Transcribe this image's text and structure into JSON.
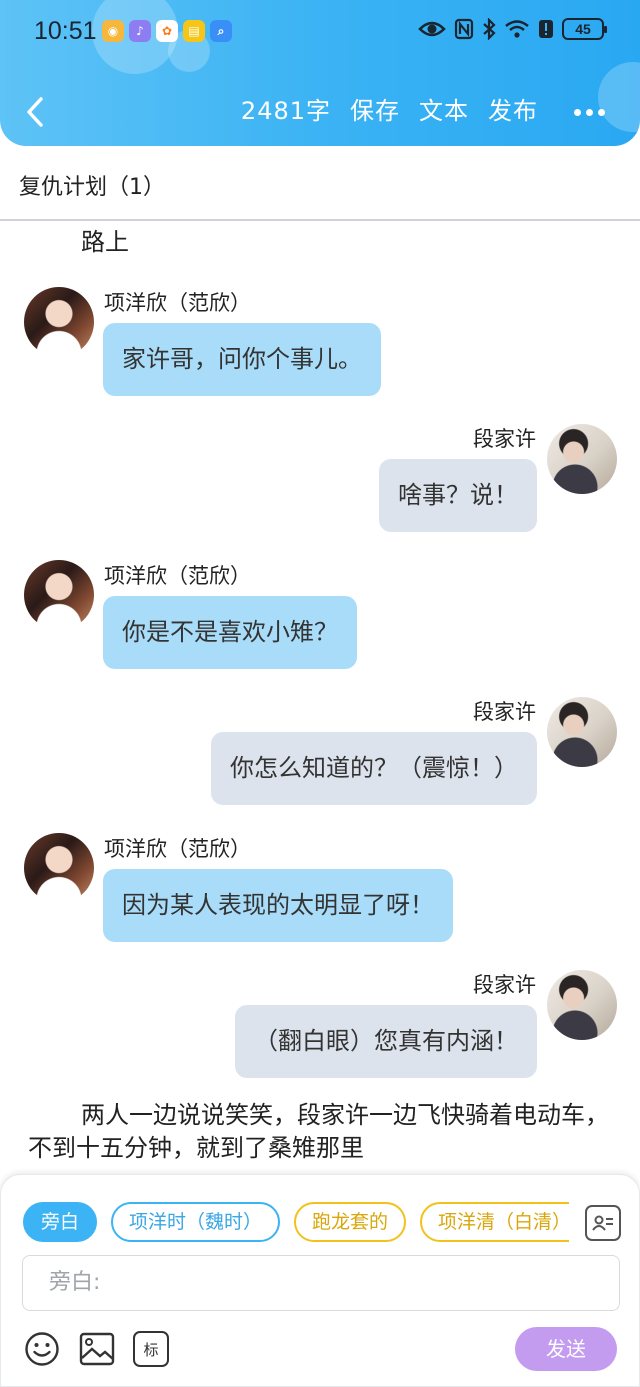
{
  "status_bar": {
    "time": "10:51",
    "battery": "45",
    "app_icons": [
      "weibo-icon",
      "music-icon",
      "taobao-icon",
      "notes-icon",
      "search-app-icon"
    ],
    "system_icons": [
      "eye-icon",
      "nfc-icon",
      "bluetooth-icon",
      "wifi-icon",
      "alert-icon",
      "battery-icon"
    ]
  },
  "toolbar": {
    "word_count": "2481字",
    "save_label": "保存",
    "text_label": "文本",
    "publish_label": "发布"
  },
  "chapter": {
    "title": "复仇计划（1）"
  },
  "narration": {
    "scene": "路上",
    "paragraph": "两人一边说说笑笑，段家许一边飞快骑着电动车，不到十五分钟，就到了桑雉那里"
  },
  "messages": [
    {
      "sender": "项洋欣（范欣）",
      "text": "家许哥，问你个事儿。",
      "side": "left"
    },
    {
      "sender": "段家许",
      "text": "啥事？说！",
      "side": "right"
    },
    {
      "sender": "项洋欣（范欣）",
      "text": "你是不是喜欢小雉？",
      "side": "left"
    },
    {
      "sender": "段家许",
      "text": "你怎么知道的？（震惊！）",
      "side": "right"
    },
    {
      "sender": "项洋欣（范欣）",
      "text": "因为某人表现的太明显了呀！",
      "side": "left"
    },
    {
      "sender": "段家许",
      "text": "（翻白眼）您真有内涵！",
      "side": "right"
    }
  ],
  "input_panel": {
    "chips": [
      "旁白",
      "项洋时（魏时）",
      "跑龙套的",
      "项洋清（白清）"
    ],
    "active_chip": "旁白",
    "input_placeholder": "旁白:",
    "mark_label": "标",
    "send_label": "发送"
  },
  "colors": {
    "header_blue": "#3bb3f4",
    "left_bubble": "#a8dcf8",
    "right_bubble": "#dde3ec",
    "send_button": "#c39cf0",
    "chip_yellow": "#f1c21b"
  }
}
